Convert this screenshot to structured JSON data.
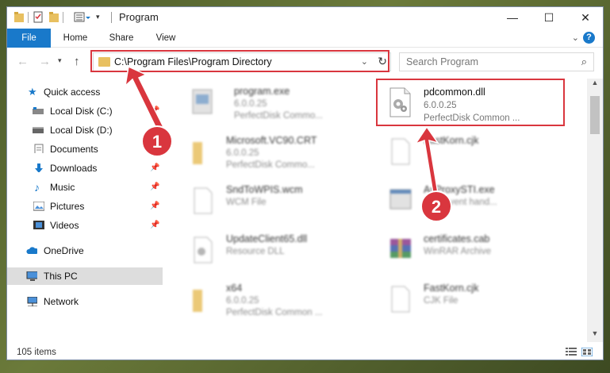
{
  "window": {
    "title": "Program",
    "controls": {
      "minimize": "—",
      "maximize": "☐",
      "close": "✕"
    }
  },
  "ribbon": {
    "tabs": [
      "File",
      "Home",
      "Share",
      "View"
    ],
    "help": "?"
  },
  "address": {
    "path": "C:\\Program Files\\Program Directory"
  },
  "search": {
    "placeholder": "Search Program"
  },
  "sidebar": {
    "items": [
      {
        "label": "Quick access",
        "icon": "star-icon"
      },
      {
        "label": "Local Disk (C:)",
        "icon": "drive-icon"
      },
      {
        "label": "Local Disk (D:)",
        "icon": "drive-icon"
      },
      {
        "label": "Documents",
        "icon": "documents-icon"
      },
      {
        "label": "Downloads",
        "icon": "download-icon"
      },
      {
        "label": "Music",
        "icon": "music-icon"
      },
      {
        "label": "Pictures",
        "icon": "pictures-icon"
      },
      {
        "label": "Videos",
        "icon": "videos-icon"
      },
      {
        "label": "OneDrive",
        "icon": "cloud-icon"
      },
      {
        "label": "This PC",
        "icon": "computer-icon"
      },
      {
        "label": "Network",
        "icon": "network-icon"
      }
    ]
  },
  "files": [
    {
      "name": "program.exe",
      "line2": "6.0.0.25",
      "line3": "PerfectDisk Commo..."
    },
    {
      "name": "pdcommon.dll",
      "line2": "6.0.0.25",
      "line3": "PerfectDisk Common ..."
    },
    {
      "name": "Microsoft.VC90.CRT",
      "line2": "6.0.0.25",
      "line3": "PerfectDisk Commo..."
    },
    {
      "name": "FastKorn.cjk",
      "line2": "",
      "line3": ""
    },
    {
      "name": "SndToWPIS.wcm",
      "line2": "WCM File",
      "line3": ""
    },
    {
      "name": "AsProxySTI.exe",
      "line2": "Kodi event hand...",
      "line3": ""
    },
    {
      "name": "UpdateClient65.dll",
      "line2": "Resource DLL",
      "line3": ""
    },
    {
      "name": "certificates.cab",
      "line2": "WinRAR Archive",
      "line3": ""
    },
    {
      "name": "x64",
      "line2": "6.0.0.25",
      "line3": "PerfectDisk Common ..."
    },
    {
      "name": "FastKorn.cjk",
      "line2": "CJK File",
      "line3": ""
    }
  ],
  "status": {
    "item_count": "105 items"
  },
  "annotations": {
    "markers": [
      "1",
      "2"
    ],
    "color": "#d9363e"
  },
  "colors": {
    "accent": "#1979ca",
    "folder": "#e8c060",
    "highlight": "#d9363e"
  }
}
